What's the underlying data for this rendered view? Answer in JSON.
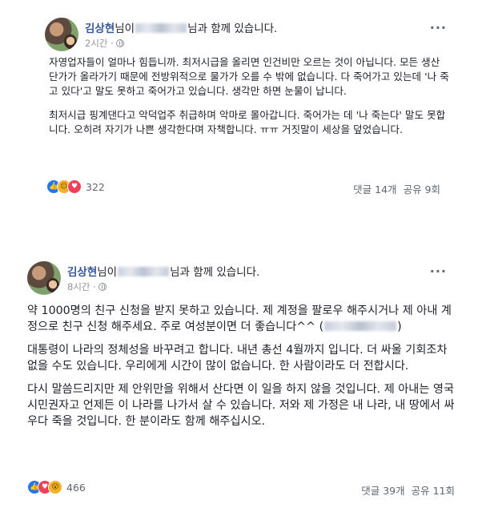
{
  "posts": [
    {
      "author": "김상현",
      "with_prefix": "님이",
      "with_suffix": "님과 함께 있습니다.",
      "time": "2시간 ·",
      "paragraphs": [
        "자영업자들이 얼마나 힘듭니까. 최저시급을 올리면 인건비만 오르는 것이 아닙니다. 모든 생산 단가가 올라가기 때문에 전방위적으로 물가가 오를 수 밖에 없습니다. 다 죽어가고 있는데 '나 죽고 있다'고 말도 못하고 죽어가고 있습니다. 생각만 하면 눈물이 납니다.",
        "최저시급 핑계댄다고 악덕업주 취급하며 악마로 몰아갑니다. 죽어가는 데 '나 죽는다' 말도 못합니다. 오히려 자기가 나쁜 생각한다며 자책합니다. ㅠㅠ 거짓말이 세상을 덮었습니다."
      ],
      "reaction_count": "322",
      "comments": "댓글 14개",
      "shares": "공유 9회"
    },
    {
      "author": "김상현",
      "with_prefix": "님이",
      "with_suffix": "님과 함께 있습니다.",
      "time": "8시간 ·",
      "paragraphs": [
        "약 1000명의 친구 신청을 받지 못하고 있습니다. 제 계정을 팔로우 해주시거나 제 아내 계정으로 친구 신청 해주세요. 주로 여성분이면 더 좋습니다^^ (",
        "대통령이 나라의 정체성을 바꾸려고 합니다. 내년 총선 4월까지 입니다. 더 싸울 기회조차 없을 수도 있습니다. 우리에게 시간이 많이 없습니다. 한 사람이라도 더 전합시다.",
        "다시 말씀드리지만 제 안위만을 위해서 산다면 이 일을 하지 않을 것입니다. 제 아내는 영국 시민권자고 언제든 이 나라를 나가서 살 수 있습니다. 저와 제 가정은 내 나라, 내 땅에서 싸우다 죽을 것입니다. 한 분이라도 함께 해주십시오."
      ],
      "paragraph1_close": ")",
      "reaction_count": "466",
      "comments": "댓글 39개",
      "shares": "공유 11회"
    }
  ],
  "icons": {
    "more": "more-dots-icon",
    "audience": "globe-icon",
    "like": "like-reaction-icon",
    "sad": "sad-reaction-icon",
    "love": "love-reaction-icon",
    "wow": "wow-reaction-icon"
  },
  "colors": {
    "author": "#365899",
    "meta": "#90949c",
    "like": "#2078f4",
    "love": "#f33e58",
    "sad": "#f7b125"
  }
}
